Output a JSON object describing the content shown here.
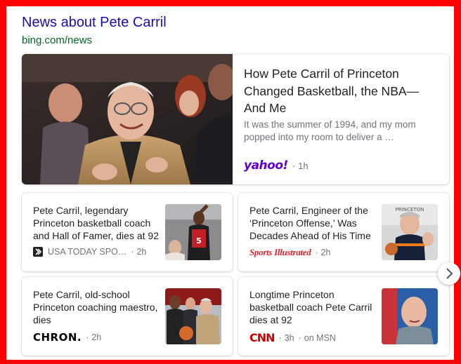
{
  "header": {
    "title": "News about Pete Carril",
    "source": "bing.com/news"
  },
  "featured": {
    "title": "How Pete Carril of Princeton Changed Basketball, the NBA—And Me",
    "snippet": "It was the summer of 1994, and my mom popped into my room to deliver a …",
    "publisher": "yahoo!",
    "age": "1h",
    "image_icon": "pete-carril-courtside-photo"
  },
  "cards": [
    {
      "title": "Pete Carril, legendary Princeton basketball coach and Hall of Famer, dies at 92",
      "publisher": "USA TODAY SPO…",
      "publisher_icon": "usa-today-sports-icon",
      "age": "2h",
      "extra": ""
    },
    {
      "title": "Pete Carril, Engineer of the ‘Princeton Offense,’ Was Decades Ahead of His Time",
      "publisher": "Sports Illustrated",
      "age": "2h",
      "extra": ""
    },
    {
      "title": "Pete Carril, old-school Princeton coaching maestro, dies",
      "publisher": "CHRON.",
      "age": "2h",
      "extra": ""
    },
    {
      "title": "Longtime Princeton basketball coach Pete Carril dies at 92",
      "publisher": "CNN",
      "age": "3h",
      "extra": "on MSN"
    }
  ],
  "colors": {
    "frame": "#ff0000",
    "link": "#1a0dab",
    "source": "#006621",
    "meta": "#70757a",
    "yahoo": "#6001d2",
    "si": "#e0242d",
    "cnn": "#cc0000"
  },
  "icons": {
    "next": "chevron-right-icon"
  }
}
